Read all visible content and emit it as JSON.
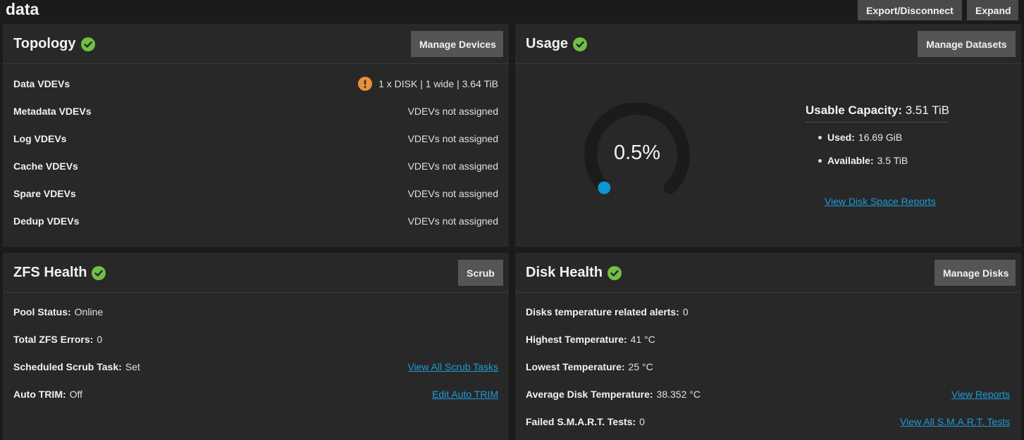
{
  "header": {
    "pool_name": "data",
    "export_label": "Export/Disconnect",
    "expand_label": "Expand"
  },
  "topology": {
    "title": "Topology",
    "button": "Manage Devices",
    "rows": [
      {
        "label": "Data VDEVs",
        "value": "1 x DISK | 1 wide | 3.64 TiB"
      },
      {
        "label": "Metadata VDEVs",
        "value": "VDEVs not assigned"
      },
      {
        "label": "Log VDEVs",
        "value": "VDEVs not assigned"
      },
      {
        "label": "Cache VDEVs",
        "value": "VDEVs not assigned"
      },
      {
        "label": "Spare VDEVs",
        "value": "VDEVs not assigned"
      },
      {
        "label": "Dedup VDEVs",
        "value": "VDEVs not assigned"
      }
    ]
  },
  "usage": {
    "title": "Usage",
    "button": "Manage Datasets",
    "percent_label": "0.5%",
    "percent_value": 0.5,
    "usable_label": "Usable Capacity:",
    "usable_value": "3.51 TiB",
    "used_label": "Used:",
    "used_value": "16.69 GiB",
    "available_label": "Available:",
    "available_value": "3.5 TiB",
    "report_link": "View Disk Space Reports"
  },
  "zfs_health": {
    "title": "ZFS Health",
    "button": "Scrub",
    "rows": [
      {
        "label": "Pool Status:",
        "value": "Online",
        "link": ""
      },
      {
        "label": "Total ZFS Errors:",
        "value": "0",
        "link": ""
      },
      {
        "label": "Scheduled Scrub Task:",
        "value": "Set",
        "link": "View All Scrub Tasks"
      },
      {
        "label": "Auto TRIM:",
        "value": "Off",
        "link": "Edit Auto TRIM"
      }
    ]
  },
  "disk_health": {
    "title": "Disk Health",
    "button": "Manage Disks",
    "rows": [
      {
        "label": "Disks temperature related alerts:",
        "value": "0",
        "link": ""
      },
      {
        "label": "Highest Temperature:",
        "value": "41 °C",
        "link": ""
      },
      {
        "label": "Lowest Temperature:",
        "value": "25 °C",
        "link": ""
      },
      {
        "label": "Average Disk Temperature:",
        "value": "38.352 °C",
        "link": "View Reports"
      },
      {
        "label": "Failed S.M.A.R.T. Tests:",
        "value": "0",
        "link": "View All S.M.A.R.T. Tests"
      }
    ]
  },
  "colors": {
    "ok_green": "#71bf44",
    "warn_orange": "#e8903a",
    "accent_blue": "#1e9bd7"
  }
}
